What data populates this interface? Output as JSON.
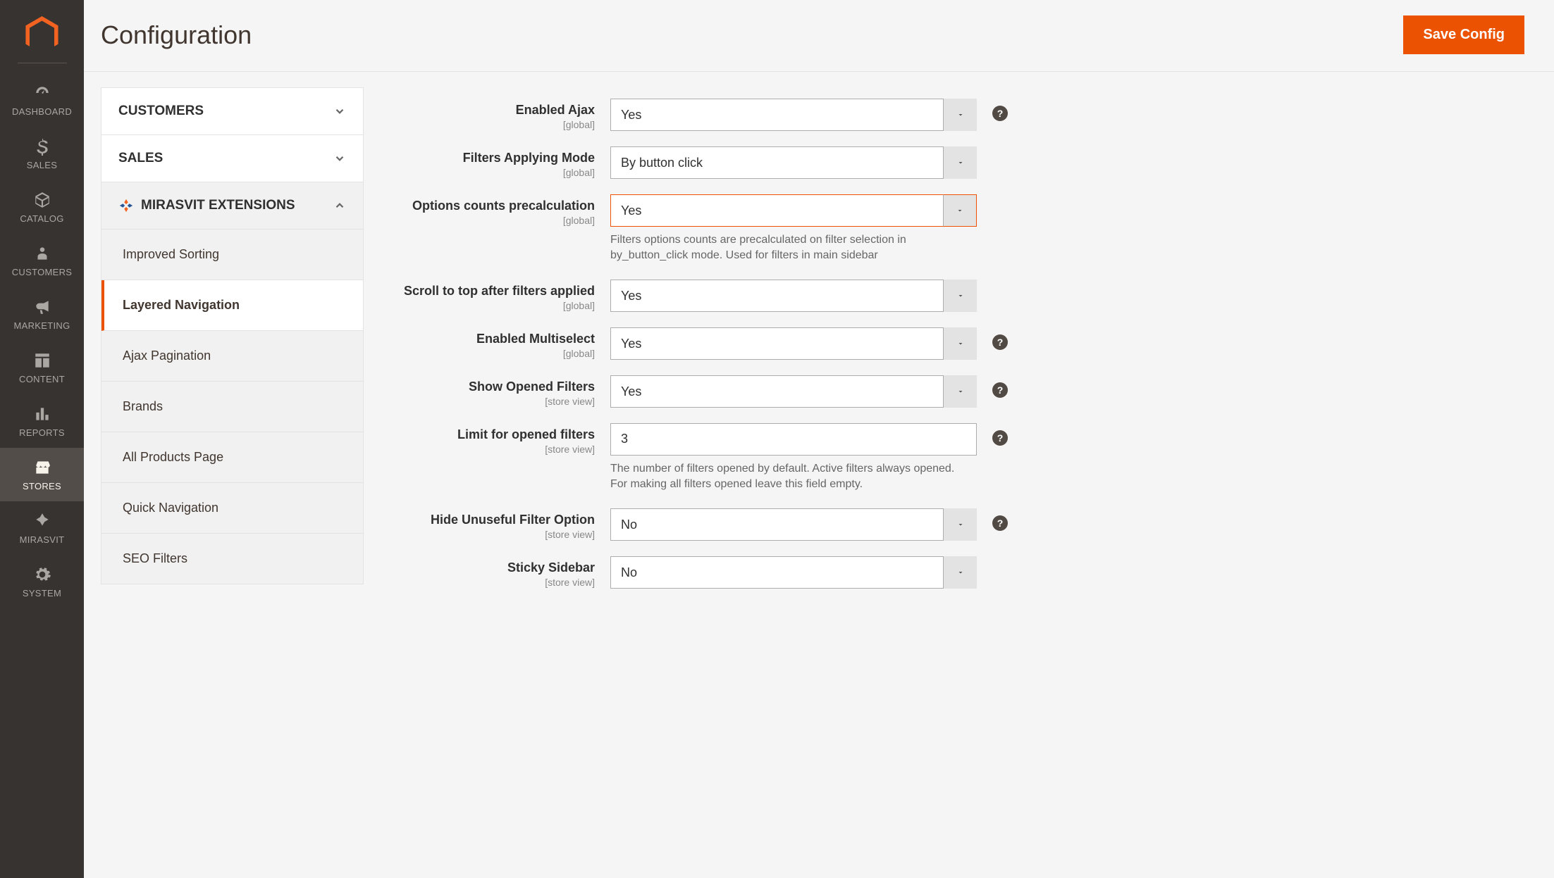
{
  "sidebar": {
    "items": [
      {
        "label": "DASHBOARD",
        "icon": "dashboard"
      },
      {
        "label": "SALES",
        "icon": "dollar"
      },
      {
        "label": "CATALOG",
        "icon": "cube"
      },
      {
        "label": "CUSTOMERS",
        "icon": "person"
      },
      {
        "label": "MARKETING",
        "icon": "megaphone"
      },
      {
        "label": "CONTENT",
        "icon": "layout"
      },
      {
        "label": "REPORTS",
        "icon": "bars"
      },
      {
        "label": "STORES",
        "icon": "storefront",
        "active": true
      },
      {
        "label": "MIRASVIT",
        "icon": "mirasvit"
      },
      {
        "label": "SYSTEM",
        "icon": "gear"
      }
    ]
  },
  "header": {
    "title": "Configuration",
    "save_label": "Save Config"
  },
  "tabs": {
    "customers_label": "CUSTOMERS",
    "sales_label": "SALES",
    "mirasvit_label": "MIRASVIT EXTENSIONS",
    "subtabs": [
      {
        "label": "Improved Sorting"
      },
      {
        "label": "Layered Navigation",
        "active": true
      },
      {
        "label": "Ajax Pagination"
      },
      {
        "label": "Brands"
      },
      {
        "label": "All Products Page"
      },
      {
        "label": "Quick Navigation"
      },
      {
        "label": "SEO Filters"
      }
    ]
  },
  "scopes": {
    "global": "[global]",
    "store_view": "[store view]"
  },
  "fields": {
    "enabled_ajax": {
      "label": "Enabled Ajax",
      "value": "Yes",
      "help": true
    },
    "filters_mode": {
      "label": "Filters Applying Mode",
      "value": "By button click"
    },
    "precalculation": {
      "label": "Options counts precalculation",
      "value": "Yes",
      "note": "Filters options counts are precalculated on filter selection in by_button_click mode. Used for filters in main sidebar",
      "highlight": true
    },
    "scroll_top": {
      "label": "Scroll to top after filters applied",
      "value": "Yes"
    },
    "multiselect": {
      "label": "Enabled Multiselect",
      "value": "Yes",
      "help": true
    },
    "show_opened": {
      "label": "Show Opened Filters",
      "value": "Yes",
      "help": true
    },
    "limit_opened": {
      "label": "Limit for opened filters",
      "value": "3",
      "note": "The number of filters opened by default. Active filters always opened.\nFor making all filters opened leave this field empty.",
      "help": true
    },
    "hide_unuseful": {
      "label": "Hide Unuseful Filter Option",
      "value": "No",
      "help": true
    },
    "sticky_sidebar": {
      "label": "Sticky Sidebar",
      "value": "No"
    }
  }
}
